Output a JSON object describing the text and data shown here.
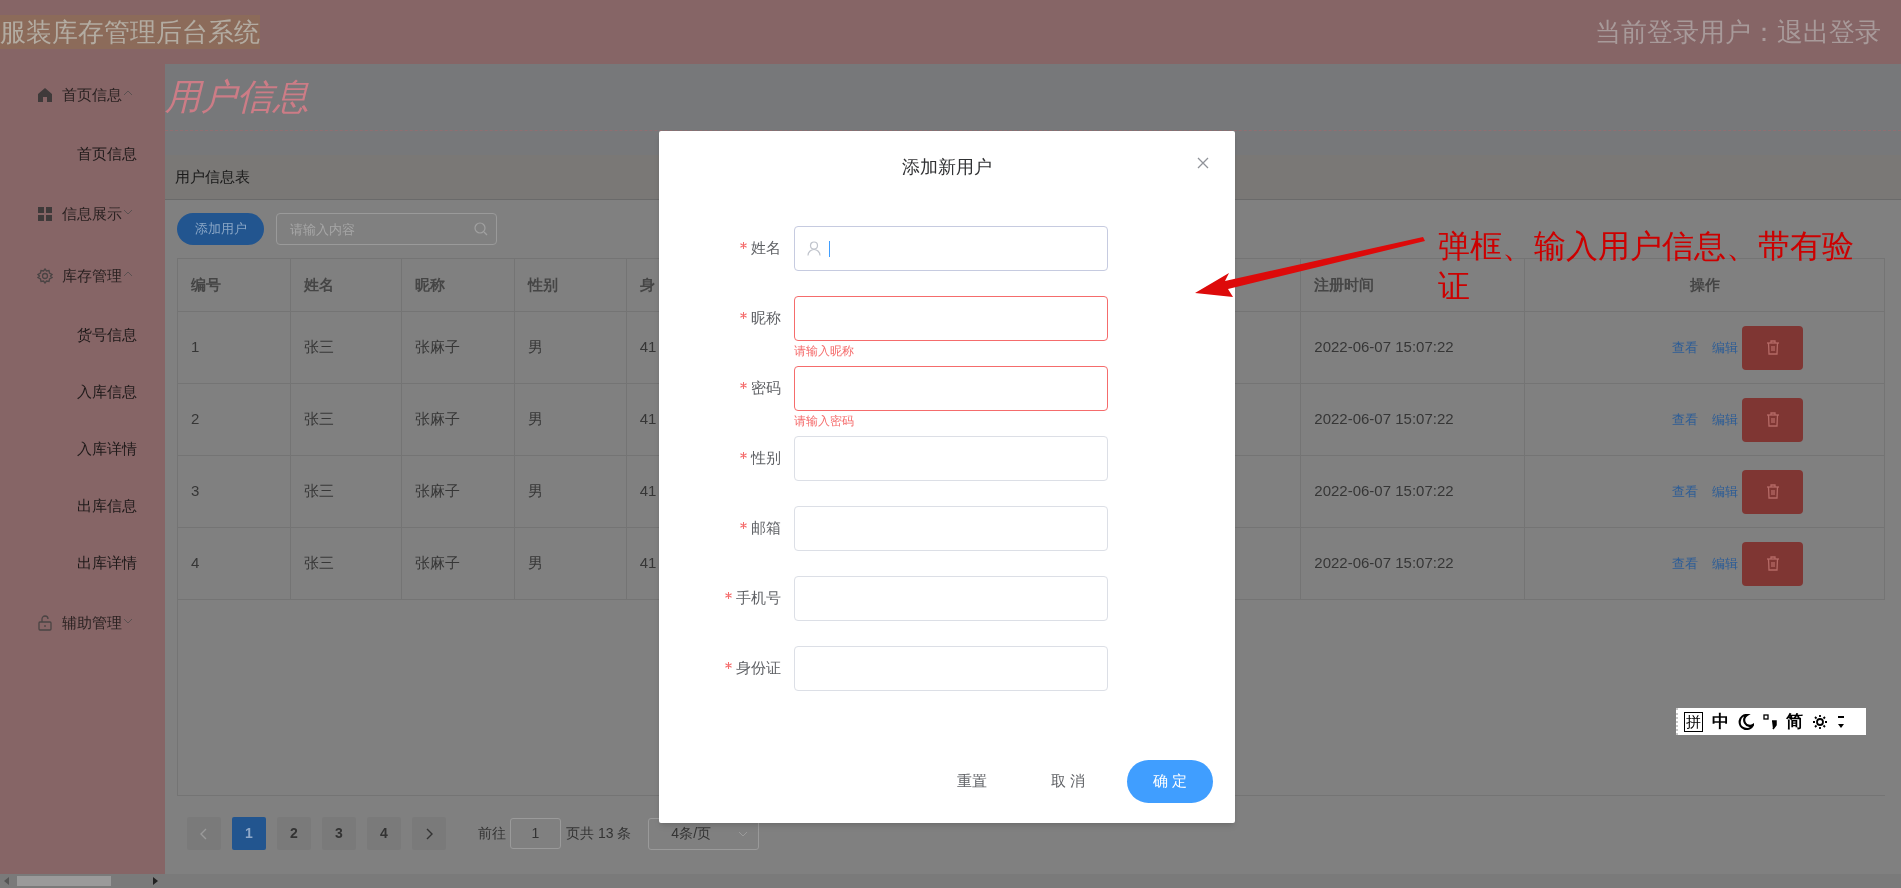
{
  "header": {
    "title": "服装库存管理后台系统",
    "user_label": "当前登录用户：",
    "logout": "退出登录"
  },
  "sidebar": {
    "items": [
      {
        "label": "首页信息",
        "expanded": true,
        "children": [
          {
            "label": "首页信息"
          }
        ]
      },
      {
        "label": "信息展示",
        "expanded": false
      },
      {
        "label": "库存管理",
        "expanded": true,
        "children": [
          {
            "label": "货号信息"
          },
          {
            "label": "入库信息"
          },
          {
            "label": "入库详情"
          },
          {
            "label": "出库信息"
          },
          {
            "label": "出库详情"
          }
        ]
      },
      {
        "label": "辅助管理",
        "expanded": false
      }
    ]
  },
  "page_title": "用户信息",
  "card": {
    "title": "用户信息表",
    "add_button": "添加用户",
    "search": {
      "placeholder": "请输入内容"
    }
  },
  "table": {
    "columns": [
      "编号",
      "姓名",
      "昵称",
      "性别",
      "身",
      "注册时间",
      "操作"
    ],
    "rows": [
      {
        "cells": [
          "1",
          "张三",
          "张麻子",
          "男",
          "41",
          "2022-06-07 15:07:22"
        ],
        "actions": [
          "查看",
          "编辑"
        ]
      },
      {
        "cells": [
          "2",
          "张三",
          "张麻子",
          "男",
          "41",
          "2022-06-07 15:07:22"
        ],
        "actions": [
          "查看",
          "编辑"
        ]
      },
      {
        "cells": [
          "3",
          "张三",
          "张麻子",
          "男",
          "41",
          "2022-06-07 15:07:22"
        ],
        "actions": [
          "查看",
          "编辑"
        ]
      },
      {
        "cells": [
          "4",
          "张三",
          "张麻子",
          "男",
          "41",
          "2022-06-07 15:07:22"
        ],
        "actions": [
          "查看",
          "编辑"
        ]
      }
    ]
  },
  "pagination": {
    "pages": [
      {
        "label": "1",
        "selected": true
      },
      {
        "label": "2",
        "selected": false
      },
      {
        "label": "3",
        "selected": false
      },
      {
        "label": "4",
        "selected": false
      }
    ],
    "goto_label": "前往",
    "goto_value": "1",
    "total": "页共 13 条",
    "page_size": "4条/页"
  },
  "dialog": {
    "title": "添加新用户",
    "fields": [
      {
        "label": "姓名",
        "kind": "prefixed",
        "required": true,
        "focused": true
      },
      {
        "label": "昵称",
        "kind": "plain",
        "required": true,
        "focused": false,
        "error": "请输入昵称"
      },
      {
        "label": "密码",
        "kind": "plain",
        "required": true,
        "focused": false,
        "error": "请输入密码"
      },
      {
        "label": "性别",
        "kind": "plain",
        "required": true,
        "focused": false
      },
      {
        "label": "邮箱",
        "kind": "plain",
        "required": true,
        "focused": false
      },
      {
        "label": "手机号",
        "kind": "plain",
        "required": true,
        "focused": false
      },
      {
        "label": "身份证",
        "kind": "plain",
        "required": true,
        "focused": false
      }
    ],
    "buttons": [
      {
        "label": "重置",
        "kind": "text"
      },
      {
        "label": "取 消",
        "kind": "text"
      },
      {
        "label": "确 定",
        "kind": "primary"
      }
    ]
  },
  "annotation": {
    "lines": [
      "弹框、输入用户信息、带有验",
      "证"
    ]
  },
  "ime_toolbar": {
    "items": [
      {
        "kind": "boxed",
        "label": "拼"
      },
      {
        "kind": "text",
        "label": "中"
      },
      {
        "kind": "moon"
      },
      {
        "kind": "punct"
      },
      {
        "kind": "text",
        "label": "简"
      },
      {
        "kind": "gear"
      },
      {
        "kind": "more"
      }
    ]
  }
}
